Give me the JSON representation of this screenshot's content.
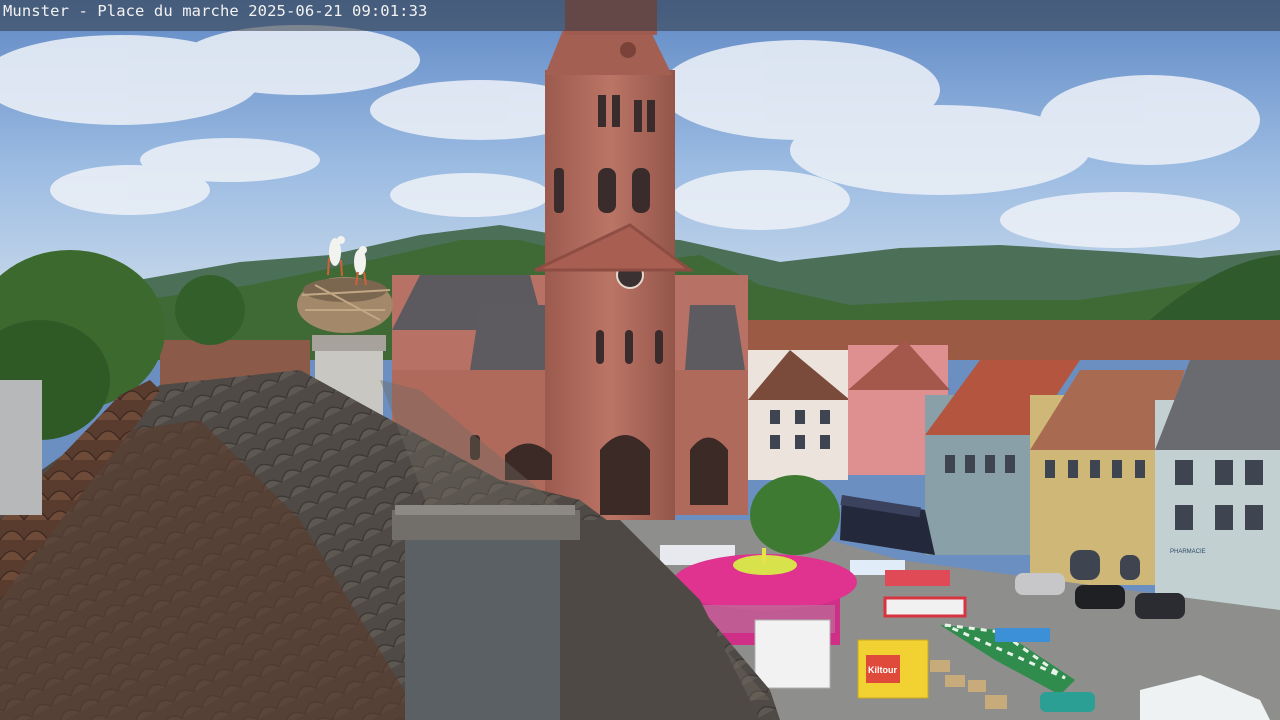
{
  "webcam": {
    "location": "Munster",
    "place": "Place du marche",
    "date": "2025-06-21",
    "time": "09:01:33"
  },
  "colors": {
    "sky": "#7ea7d8",
    "church_sandstone": "#b06a5c",
    "roof_slate": "#55504c",
    "market_umbrella": "#e0338f",
    "hills": "#3f6a35"
  },
  "market_signs": {
    "truck_sign": "Kiltour",
    "pharmacy_sign": "PHARMACIE"
  }
}
